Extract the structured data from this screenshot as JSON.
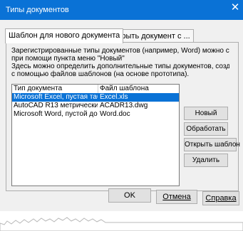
{
  "window": {
    "title": "Типы документов",
    "close_glyph": "✕"
  },
  "tabs": [
    {
      "label": "Шаблон для нового документа"
    },
    {
      "label": "Открыть документ с ..."
    }
  ],
  "description": {
    "line1": "Зарегистрированные типы документов (например, Word) можно создать",
    "line2": "при помощи пункта меню \"Новый\"",
    "line3": "Здесь можно определить дополнительные типы документов, создающиеся",
    "line4": "с помощью файлов шаблонов (на основе прототипа)."
  },
  "list": {
    "headers": [
      "Тип документа",
      "Файл шаблона"
    ],
    "rows": [
      {
        "type": "Microsoft Excel, пустая таб...",
        "file": "Excel.xls",
        "selected": true
      },
      {
        "type": "AutoCAD R13 метрически...",
        "file": "ACADR13.dwg",
        "selected": false
      },
      {
        "type": "Microsoft Word, пустой до...",
        "file": "Word.doc",
        "selected": false
      }
    ]
  },
  "side_buttons": {
    "new": "Новый",
    "process": "Обработать",
    "open_template": "Открыть шаблон",
    "delete": "Удалить"
  },
  "bottom_buttons": {
    "ok": "OK",
    "cancel": "Отмена",
    "help": "Справка"
  },
  "colors": {
    "titlebar": "#0a72d6",
    "selection": "#0a72d6"
  }
}
